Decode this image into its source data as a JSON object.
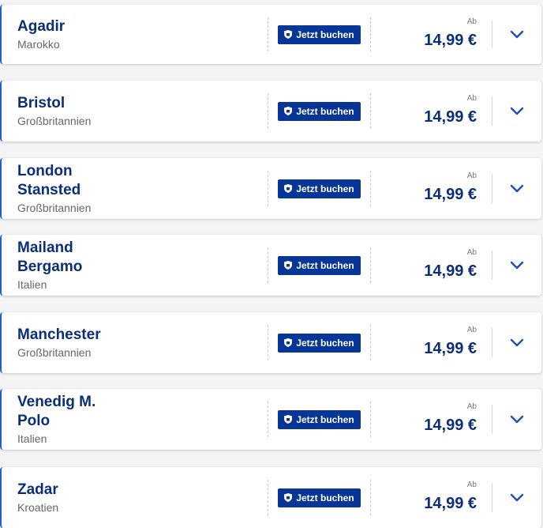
{
  "common": {
    "book_label": "Jetzt buchen",
    "from_label": "Ab",
    "accent": "#083696",
    "text_color": "#0b2e7a"
  },
  "destinations": [
    {
      "city": "Agadir",
      "country": "Marokko",
      "price": "14,99 €"
    },
    {
      "city": "Bristol",
      "country": "Großbritannien",
      "price": "14,99 €"
    },
    {
      "city": "London\nStansted",
      "country": "Großbritannien",
      "price": "14,99 €"
    },
    {
      "city": "Mailand\nBergamo",
      "country": "Italien",
      "price": "14,99 €"
    },
    {
      "city": "Manchester",
      "country": "Großbritannien",
      "price": "14,99 €"
    },
    {
      "city": "Venedig M.\nPolo",
      "country": "Italien",
      "price": "14,99 €"
    },
    {
      "city": "Zadar",
      "country": "Kroatien",
      "price": "14,99 €"
    }
  ]
}
